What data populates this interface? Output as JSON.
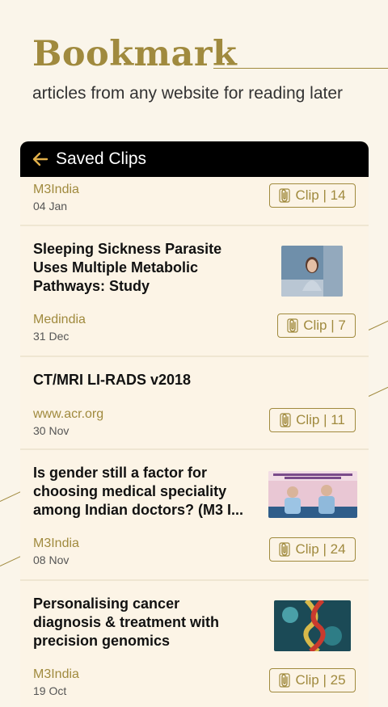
{
  "hero": {
    "title": "Bookmark",
    "subtitle": "articles from any website for reading later"
  },
  "header": {
    "title": "Saved Clips",
    "back_icon": "arrow-left-icon"
  },
  "colors": {
    "accent": "#a08a3e",
    "background": "#faf5ea",
    "card": "#fcf4e6",
    "header": "#000000"
  },
  "clips": [
    {
      "title": "",
      "source": "M3India",
      "date": "04 Jan",
      "clip_label": "Clip | 14"
    },
    {
      "title": "Sleeping Sickness Parasite Uses Multiple Metabolic Pathways: Study",
      "source": "Medindia",
      "date": "31 Dec",
      "clip_label": "Clip | 7"
    },
    {
      "title": "CT/MRI LI-RADS v2018",
      "source": "www.acr.org",
      "date": "30 Nov",
      "clip_label": "Clip | 11"
    },
    {
      "title": "Is gender still a factor for choosing medical speciality among Indian doctors? (M3 I...",
      "source": "M3India",
      "date": "08 Nov",
      "clip_label": "Clip | 24"
    },
    {
      "title": "Personalising cancer diagnosis & treatment with precision genomics",
      "source": "M3India",
      "date": "19 Oct",
      "clip_label": "Clip | 25"
    }
  ]
}
